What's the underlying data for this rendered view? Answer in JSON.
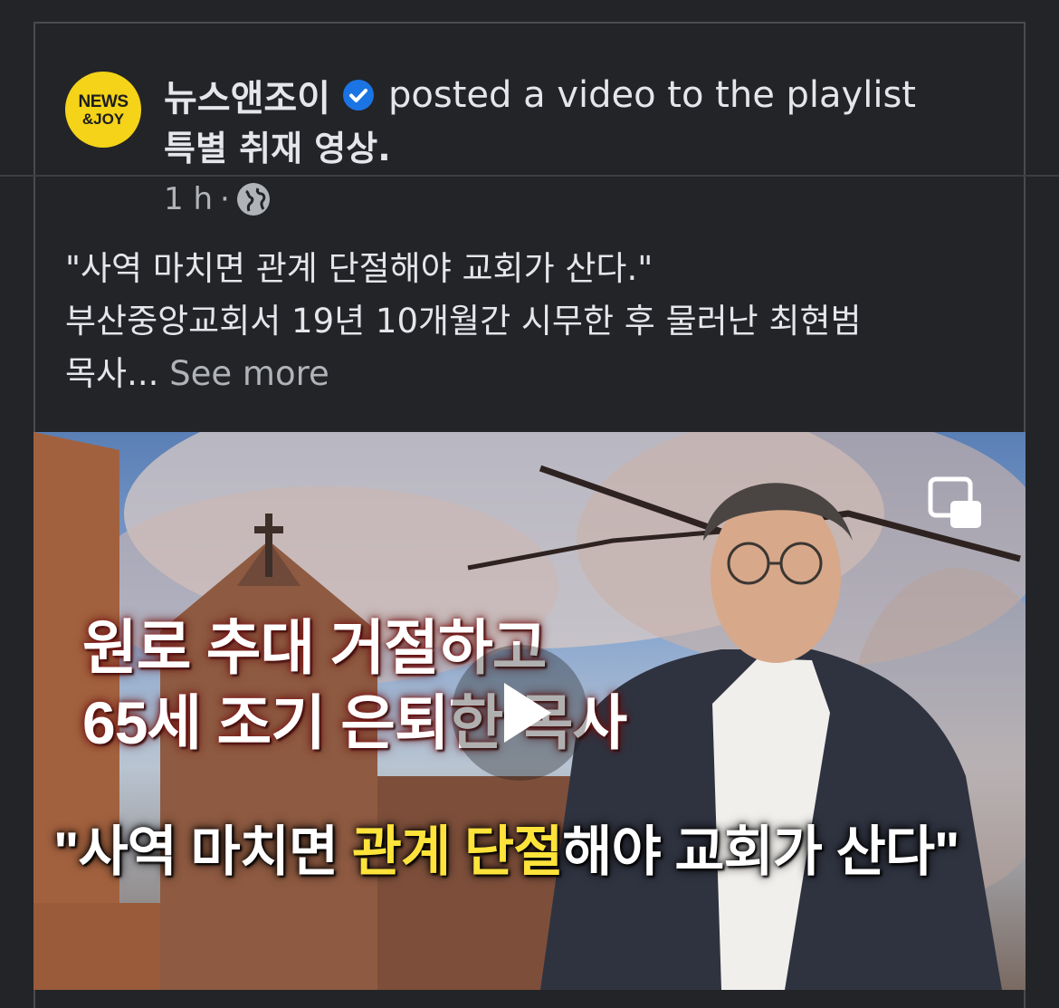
{
  "post": {
    "page_name": "뉴스앤조이",
    "action_text": "posted a video to the playlist",
    "playlist_name": "특별 취재 영상.",
    "time": "1 h",
    "dot": "·",
    "privacy_icon": "globe-icon",
    "avatar": {
      "line1": "NEWS",
      "line2": "&JOY"
    },
    "text_lines": [
      "\"사역 마치면 관계 단절해야 교회가 산다.\"",
      "부산중앙교회서 19년 10개월간 시무한 후 물러난 최현범",
      "목사..."
    ],
    "see_more": "See more"
  },
  "video": {
    "overlay_line1": "원로 추대 거절하고",
    "overlay_line2": "65세 조기 은퇴한 목사",
    "caption_part1": "\"사역 마치면 ",
    "caption_highlight": "관계 단절",
    "caption_part2": "해야 교회가 산다\"",
    "play_icon": "play-icon",
    "pip_icon": "picture-in-picture-icon"
  },
  "colors": {
    "background": "#232427",
    "verified": "#1b74e4",
    "avatar": "#f4d318",
    "caption_highlight": "#ffe33a"
  }
}
